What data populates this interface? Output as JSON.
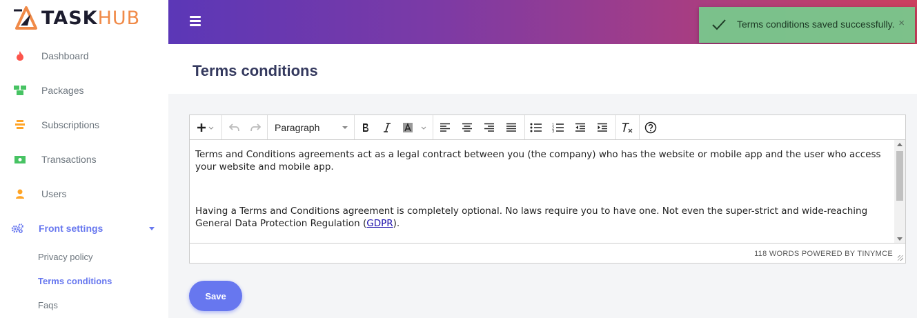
{
  "brand": {
    "task": "TASK",
    "hub": "HUB"
  },
  "sidebar": {
    "items": [
      {
        "label": "Dashboard",
        "icon": "fire-icon",
        "color": "#fc544b"
      },
      {
        "label": "Packages",
        "icon": "boxes-icon",
        "color": "#47c363"
      },
      {
        "label": "Subscriptions",
        "icon": "layers-icon",
        "color": "#ffa426"
      },
      {
        "label": "Transactions",
        "icon": "money-bill-icon",
        "color": "#47c363"
      },
      {
        "label": "Users",
        "icon": "user-icon",
        "color": "#ffa426"
      },
      {
        "label": "Front settings",
        "icon": "cogs-icon",
        "color": "#6777ef"
      }
    ],
    "subitems": [
      {
        "label": "Privacy policy"
      },
      {
        "label": "Terms conditions"
      },
      {
        "label": "Faqs"
      }
    ]
  },
  "toast": {
    "message": "Terms conditions saved successfully.",
    "close": "×"
  },
  "page": {
    "title": "Terms conditions"
  },
  "editor": {
    "format": "Paragraph",
    "paragraphs": [
      "Terms and Conditions agreements act as a legal contract between you (the company) who has the website or mobile app and the user who access your website and mobile app.",
      "Having a Terms and Conditions agreement is completely optional. No laws require you to have one. Not even the super-strict and wide-reaching General Data Protection Regulation ("
    ],
    "link_text": "GDPR",
    "link_suffix": ").",
    "status": "118 WORDS POWERED BY TINYMCE"
  },
  "save_label": "Save",
  "colors": {
    "accent": "#6777ef",
    "toast_bg": "#78c88c"
  }
}
